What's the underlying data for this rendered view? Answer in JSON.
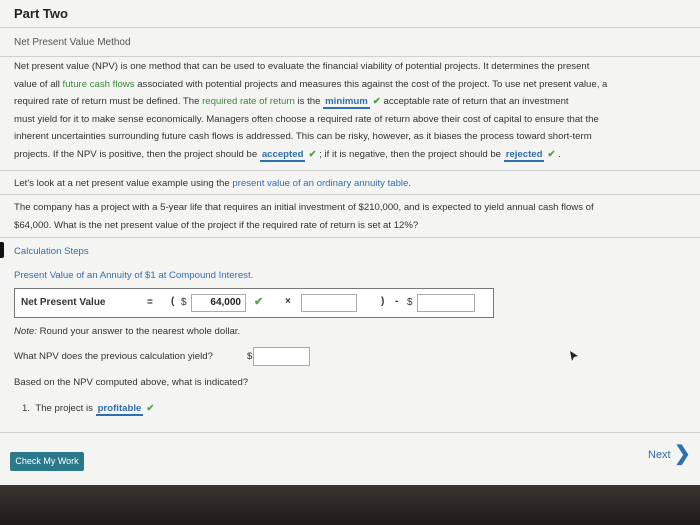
{
  "header": {
    "title": "Part Two"
  },
  "section": {
    "title": "Net Present Value Method"
  },
  "paragraph": {
    "l1": "Net present value (NPV) is one method that can be used to evaluate the financial viability of potential projects. It determines the present",
    "l2a": "value of all ",
    "l2b": "future cash flows",
    "l2c": " associated with potential projects and measures this against the cost of the project. To use net present value, a",
    "l3a": "required rate of return must be defined. The ",
    "l3b": "required rate of return",
    "l3c": " is the ",
    "ans1": "minimum",
    "l3d": " acceptable rate of return that an investment",
    "l4": "must yield for it to make sense economically. Managers often choose a required rate of return above their cost of capital to ensure that the",
    "l5": "inherent uncertainties surrounding future cash flows is addressed. This can be risky, however, as it biases the process toward short-term",
    "l6a": "projects. If the NPV is positive, then the project should be ",
    "ans2": "accepted",
    "l6b": " ; if it is negative, then the project should be ",
    "ans3": "rejected",
    "l6c": " ."
  },
  "example": {
    "a": "Let's look at a net present value example using the ",
    "b": "present value of an ordinary annuity table",
    "c": "."
  },
  "problem": {
    "l1": "The company has a project with a 5-year life that requires an initial investment of $210,000, and is expected to yield annual cash flows of",
    "l2": "$64,000. What is the net present value of the project if the required rate of return is set at 12%?"
  },
  "calc": {
    "steps_label": "Calculation Steps",
    "table_link": "Present Value of an Annuity of $1 at Compound Interest.",
    "npv_label": "Net Present Value",
    "equals": "=",
    "open_paren": "(",
    "dollar": "$",
    "cash_flow_value": "64,000",
    "times": "×",
    "close_paren": ")",
    "minus": "-",
    "dollar2": "$"
  },
  "note": {
    "prefix": "Note:",
    "text": " Round your answer to the nearest whole dollar."
  },
  "q1": {
    "text": "What NPV does the previous calculation yield?",
    "dollar": "$"
  },
  "q2": {
    "text": "Based on the NPV computed above, what is indicated?"
  },
  "q3": {
    "num": "1.",
    "text": "The project is ",
    "answer": "profitable"
  },
  "footer": {
    "check_button": "Check My Work",
    "next": "Next"
  },
  "icons": {
    "check": "✔",
    "chevron": "❯"
  }
}
